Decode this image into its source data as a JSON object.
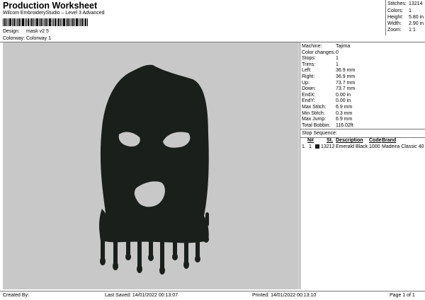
{
  "header": {
    "title": "Production Worksheet",
    "subtitle": "Wilcom EmbroideryStudio – Level 3 Advanced",
    "design_label": "Design:",
    "design_value": "mask v2 5",
    "colorway_label": "Colorway:",
    "colorway_value": "Colorway 1"
  },
  "summary": [
    {
      "label": "Stitches:",
      "value": "13214"
    },
    {
      "label": "Colors:",
      "value": "1"
    },
    {
      "label": "Height:",
      "value": "5.80 in"
    },
    {
      "label": "Width:",
      "value": "2.90 in"
    },
    {
      "label": "Zoom:",
      "value": "1:1"
    }
  ],
  "properties": [
    {
      "label": "Machine:",
      "value": "Tajima"
    },
    {
      "label": "Color changes:",
      "value": "0"
    },
    {
      "label": "Stops:",
      "value": "1"
    },
    {
      "label": "Trims:",
      "value": "1"
    },
    {
      "label": "Left:",
      "value": "36.9 mm"
    },
    {
      "label": "Right:",
      "value": "36.9 mm"
    },
    {
      "label": "Up:",
      "value": "73.7 mm"
    },
    {
      "label": "Down:",
      "value": "73.7 mm"
    },
    {
      "label": "EndX:",
      "value": "0.00 in"
    },
    {
      "label": "EndY:",
      "value": "0.00 in"
    },
    {
      "label": "Max Stitch:",
      "value": "6.9 mm"
    },
    {
      "label": "Min Stitch:",
      "value": "0.3 mm"
    },
    {
      "label": "Max Jump:",
      "value": "6.9 mm"
    },
    {
      "label": "Total Bobbin:",
      "value": "116.02ft"
    }
  ],
  "stop_sequence": {
    "title": "Stop Sequence:",
    "headers": {
      "num": "N#",
      "st": "St.",
      "description": "Description",
      "code": "Code",
      "brand": "Brand"
    },
    "rows": [
      {
        "index": "1.",
        "num": "1",
        "swatch": "#1a1a1a",
        "st": "13212",
        "description": "Emerald Black",
        "code": "1000",
        "brand": "Madeira Classic 40"
      }
    ]
  },
  "footer": {
    "created_by": "Created By:",
    "last_saved": "Last Saved: 14/01/2022 00:13:07",
    "printed": "Printed: 14/01/2022 00:13:10",
    "page": "Page 1 of 1"
  },
  "colors": {
    "canvas_bg": "#c8c8c8",
    "thread": "#1b1f1c"
  }
}
